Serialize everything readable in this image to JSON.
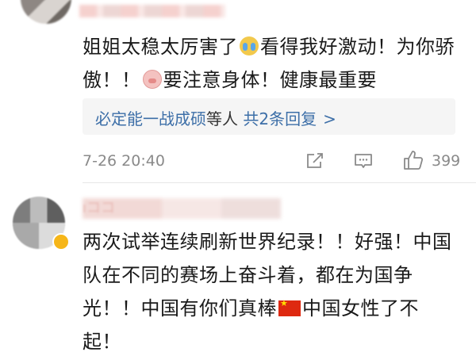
{
  "comments": [
    {
      "username": "",
      "text_part1": "姐姐太稳太厉害了",
      "emoji1": "crying-face-emoji",
      "text_part2": "看得我好激动！为你骄傲！！",
      "emoji2": "pig-face-emoji",
      "text_part3": "要注意身体！健康最重要",
      "reply_summary": {
        "names": "必定能一战成硕",
        "middle": "等人",
        "count_text": "共2条回复",
        "chevron": ">"
      },
      "timestamp": "7-26 20:40",
      "like_count": "399"
    },
    {
      "username": "ıココ",
      "text_part1": "两次试举连续刷新世界纪录！！好强！中国队在不同的赛场上奋斗着，都在为国争光！！中国有你们真棒",
      "flag": "china-flag",
      "text_part2": "中国女性了不起！"
    }
  ],
  "colors": {
    "link": "#3d6fa8",
    "meta": "#8a8a8a",
    "reply_bg": "#f5f5f5",
    "text": "#1a1a1a"
  }
}
